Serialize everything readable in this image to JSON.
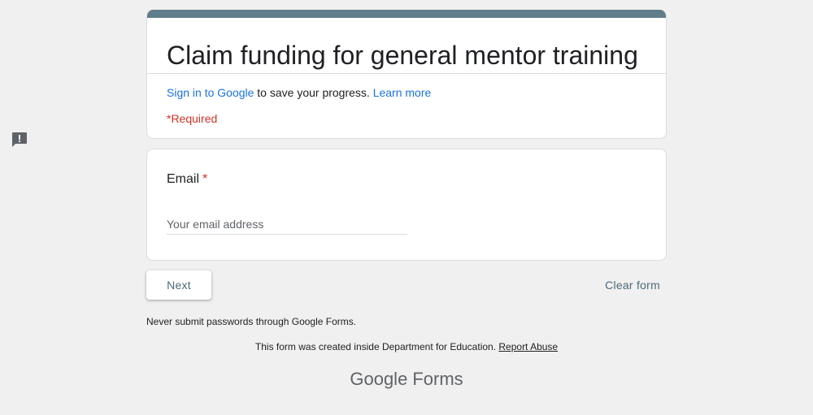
{
  "form": {
    "title": "Claim funding for general mentor training",
    "accent_color": "#607d8b",
    "sign_in_link": "Sign in to Google",
    "sign_in_rest": " to save your progress. ",
    "learn_more": "Learn more",
    "required_note": "*Required"
  },
  "question": {
    "label": "Email",
    "required_star": "*",
    "placeholder": "Your email address",
    "value": ""
  },
  "actions": {
    "next_label": "Next",
    "clear_label": "Clear form"
  },
  "footer": {
    "never_submit": "Never submit passwords through Google Forms.",
    "created_text": "This form was created inside Department for Education. ",
    "report_abuse": "Report Abuse",
    "logo_google": "Google",
    "logo_forms": "Forms"
  },
  "icons": {
    "feedback": "feedback-icon"
  }
}
